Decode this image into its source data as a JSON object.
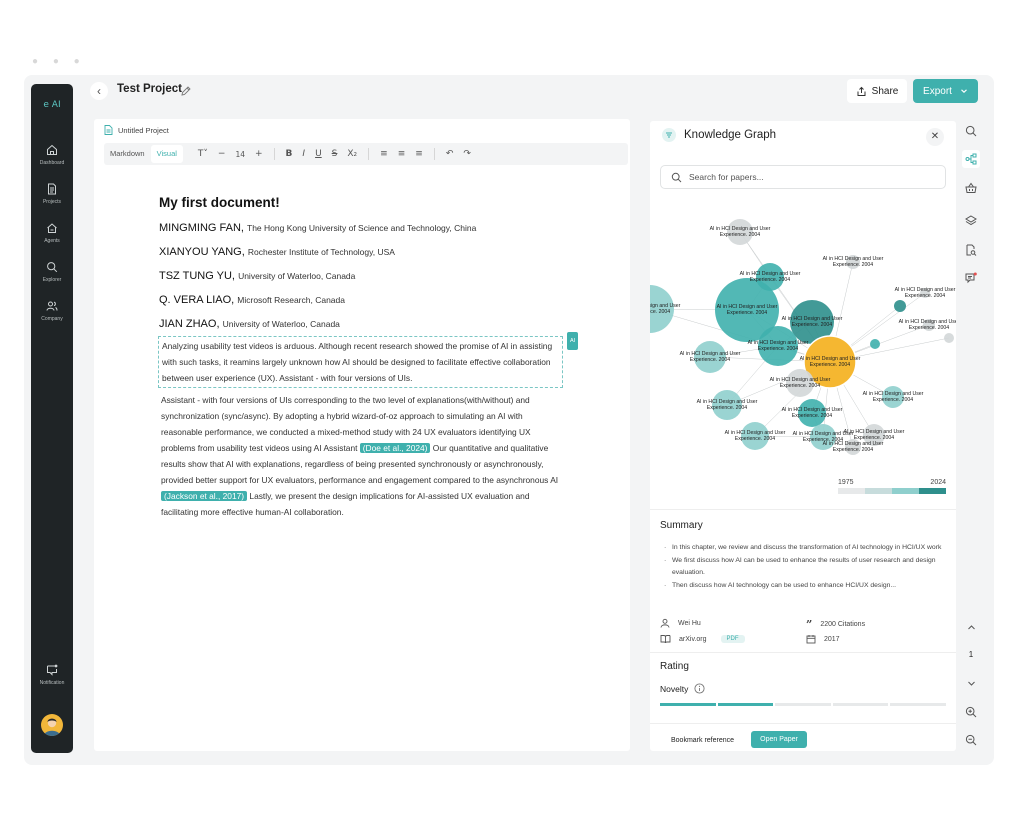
{
  "app": {
    "logo": "e AI"
  },
  "sidebar": {
    "items": [
      {
        "label": "Dashboard",
        "icon": "home-icon"
      },
      {
        "label": "Projects",
        "icon": "document-icon"
      },
      {
        "label": "Agents",
        "icon": "agent-icon"
      },
      {
        "label": "Explorer",
        "icon": "search-icon"
      },
      {
        "label": "Company",
        "icon": "users-icon"
      }
    ],
    "notification_label": "Notification"
  },
  "header": {
    "project_title": "Test Project",
    "share_label": "Share",
    "export_label": "Export"
  },
  "editor": {
    "tab_label": "Untitled Project",
    "modes": [
      "Markdown",
      "Visual"
    ],
    "active_mode": "Visual",
    "font_size": "14",
    "doc_title": "My first document!",
    "authors": [
      {
        "name": "MINGMING FAN,",
        "affil": "The Hong Kong University of Science and Technology, China"
      },
      {
        "name": "XIANYOU YANG,",
        "affil": "Rochester Institute of Technology, USA"
      },
      {
        "name": "TSZ TUNG YU,",
        "affil": "University of Waterloo, Canada"
      },
      {
        "name": "Q. VERA LIAO,",
        "affil": "Microsoft Research, Canada"
      },
      {
        "name": "JIAN ZHAO,",
        "affil": "University of Waterloo, Canada"
      }
    ],
    "ai_tag": "AI",
    "selected_paragraph": "Analyzing usability test videos is arduous. Although recent research showed the promise of AI in assisting with such tasks, it reamins largely unknown how AI should be designed to facilitate effective collaboration between user experience (UX). Assistant - with four versions of UIs.",
    "para2_part1": "Assistant - with four versions of UIs corresponding to the two level of explanations(with/without) and synchronization (sync/async). By adopting a hybrid wizard-of-oz approach to simulating an AI with reasonable performance, we conducted a mixed-method study with 24 UX evaluators identifying UX problems from usability test videos using AI Assistant ",
    "cite1": "(Doe et al., 2024)",
    "para2_part2": " Our quantitative and qualitative results show that AI with explanations, regardless of being presented synchronously or asynchronously, provided better support for UX evaluators, performance and engagement compared to the asynchronous AI ",
    "cite2": "(Jackson et al., 2017)",
    "para2_part3": " Lastly, we present the design implications for AI-assisted UX evaluation and facilitating more effective human-AI collaboration."
  },
  "knowledge_graph": {
    "title": "Knowledge Graph",
    "search_placeholder": "Search for papers...",
    "node_label_line1": "AI in HCI Design and User",
    "node_label_line2": "Experience. 2004",
    "year_start": "1975",
    "year_end": "2024",
    "colors": {
      "light": "#d3d7d8",
      "mid": "#8fcfcd",
      "teal": "#3fb0ad",
      "dark": "#2e8f8c",
      "selected": "#f5b731"
    },
    "summary_title": "Summary",
    "summary_items": [
      "In this chapter, we review and discuss the transformation of AI technology in HCI/UX work",
      "We first discuss how AI can be used to enhance the results of user research and design evaluation.",
      "Then discuss how AI technology can be used to enhance HCI/UX design..."
    ],
    "author": "Wei Hu",
    "citations": "2200 Citations",
    "source": "arXiv.org",
    "pdf_label": "PDF",
    "year": "2017",
    "rating_title": "Rating",
    "novelty_label": "Novelty",
    "novelty_level": 0.4,
    "bookmark_label": "Bookmark reference",
    "open_paper_label": "Open Paper"
  },
  "pager": {
    "page": "1"
  }
}
